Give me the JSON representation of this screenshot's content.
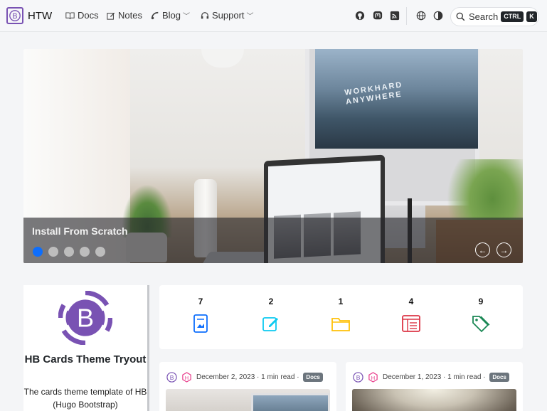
{
  "navbar": {
    "brand": "HTW",
    "items": [
      {
        "label": "Docs"
      },
      {
        "label": "Notes"
      },
      {
        "label": "Blog"
      },
      {
        "label": "Support"
      }
    ],
    "search": {
      "label": "Search",
      "kbd1": "CTRL",
      "kbd2": "K"
    }
  },
  "carousel": {
    "caption": "Install From Scratch",
    "monitor_text_1": "WORKHARD",
    "monitor_text_2": "ANYWHERE",
    "slides": 5,
    "active_slide": 1
  },
  "profile": {
    "title": "HB Cards Theme Tryout",
    "description": "The cards theme template of HB (Hugo Bootstrap)"
  },
  "stats": [
    {
      "count": "7",
      "icon": "docs-icon",
      "color": "#0d6efd"
    },
    {
      "count": "2",
      "icon": "notes-icon",
      "color": "#0dcaf0"
    },
    {
      "count": "1",
      "icon": "folder-icon",
      "color": "#ffc107"
    },
    {
      "count": "4",
      "icon": "list-icon",
      "color": "#dc3545"
    },
    {
      "count": "9",
      "icon": "tag-icon",
      "color": "#198754"
    }
  ],
  "posts": [
    {
      "date": "December 2, 2023",
      "read": " · 1 min read · ",
      "badge": "Docs"
    },
    {
      "date": "December 1, 2023",
      "read": " · 1 min read · ",
      "badge": "Docs"
    }
  ],
  "colors": {
    "accent": "#7952b3",
    "active_dot": "#0d6efd"
  }
}
